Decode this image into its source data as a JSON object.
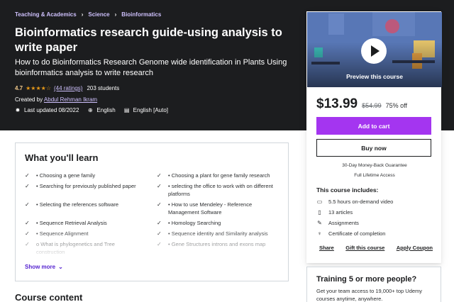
{
  "breadcrumb": [
    {
      "label": "Teaching & Academics"
    },
    {
      "label": "Science"
    },
    {
      "label": "Bioinformatics"
    }
  ],
  "course": {
    "title": "Bioinformatics research guide-using analysis to write paper",
    "subtitle": "How to do Bioinformatics Research Genome wide identification in Plants Using bioinformatics analysis to write research",
    "rating": "4.7",
    "rating_value": 4.7,
    "stars": "★★★★☆",
    "ratings_link": "(44 ratings)",
    "students": "203 students",
    "created_prefix": "Created by",
    "author": "Abdul Rehman Ikram",
    "last_updated": "Last updated 08/2022",
    "language": "English",
    "captions": "English [Auto]"
  },
  "learn": {
    "title": "What you'll learn",
    "items": [
      "Choosing a gene family",
      "Choosing a plant for gene family research",
      "Searching for previously published paper",
      "selecting the office to work with on different platforms",
      "Selecting the references software",
      "How to use Mendeley - Reference Management Software",
      "Sequence Retrieval Analysis",
      "Homology Searching",
      "Sequence Alignment",
      "Sequence identity and Similarity analysis",
      "What is phylogenetics and Tree construction",
      "Gene Structures introns and exons map"
    ],
    "show_more": "Show more"
  },
  "course_content_title": "Course content",
  "sidebar": {
    "preview_label": "Preview this course",
    "price": "$13.99",
    "original_price": "$54.99",
    "discount": "75% off",
    "add_to_cart": "Add to cart",
    "buy_now": "Buy now",
    "guarantee": "30-Day Money-Back Guarantee",
    "lifetime": "Full Lifetime Access",
    "includes_title": "This course includes:",
    "includes": [
      {
        "icon": "video-icon",
        "label": "5.5 hours on-demand video"
      },
      {
        "icon": "article-icon",
        "label": "13 articles"
      },
      {
        "icon": "assignment-icon",
        "label": "Assignments"
      },
      {
        "icon": "certificate-icon",
        "label": "Certificate of completion"
      }
    ],
    "share": "Share",
    "gift": "Gift this course",
    "coupon": "Apply Coupon"
  },
  "teams": {
    "title": "Training 5 or more people?",
    "text": "Get your team access to 19,000+ top Udemy courses anytime, anywhere."
  },
  "colors": {
    "hero_bg": "#1c1d1f",
    "accent_link": "#cec0fc",
    "cart_button": "#a435f0",
    "star": "#e59819"
  }
}
